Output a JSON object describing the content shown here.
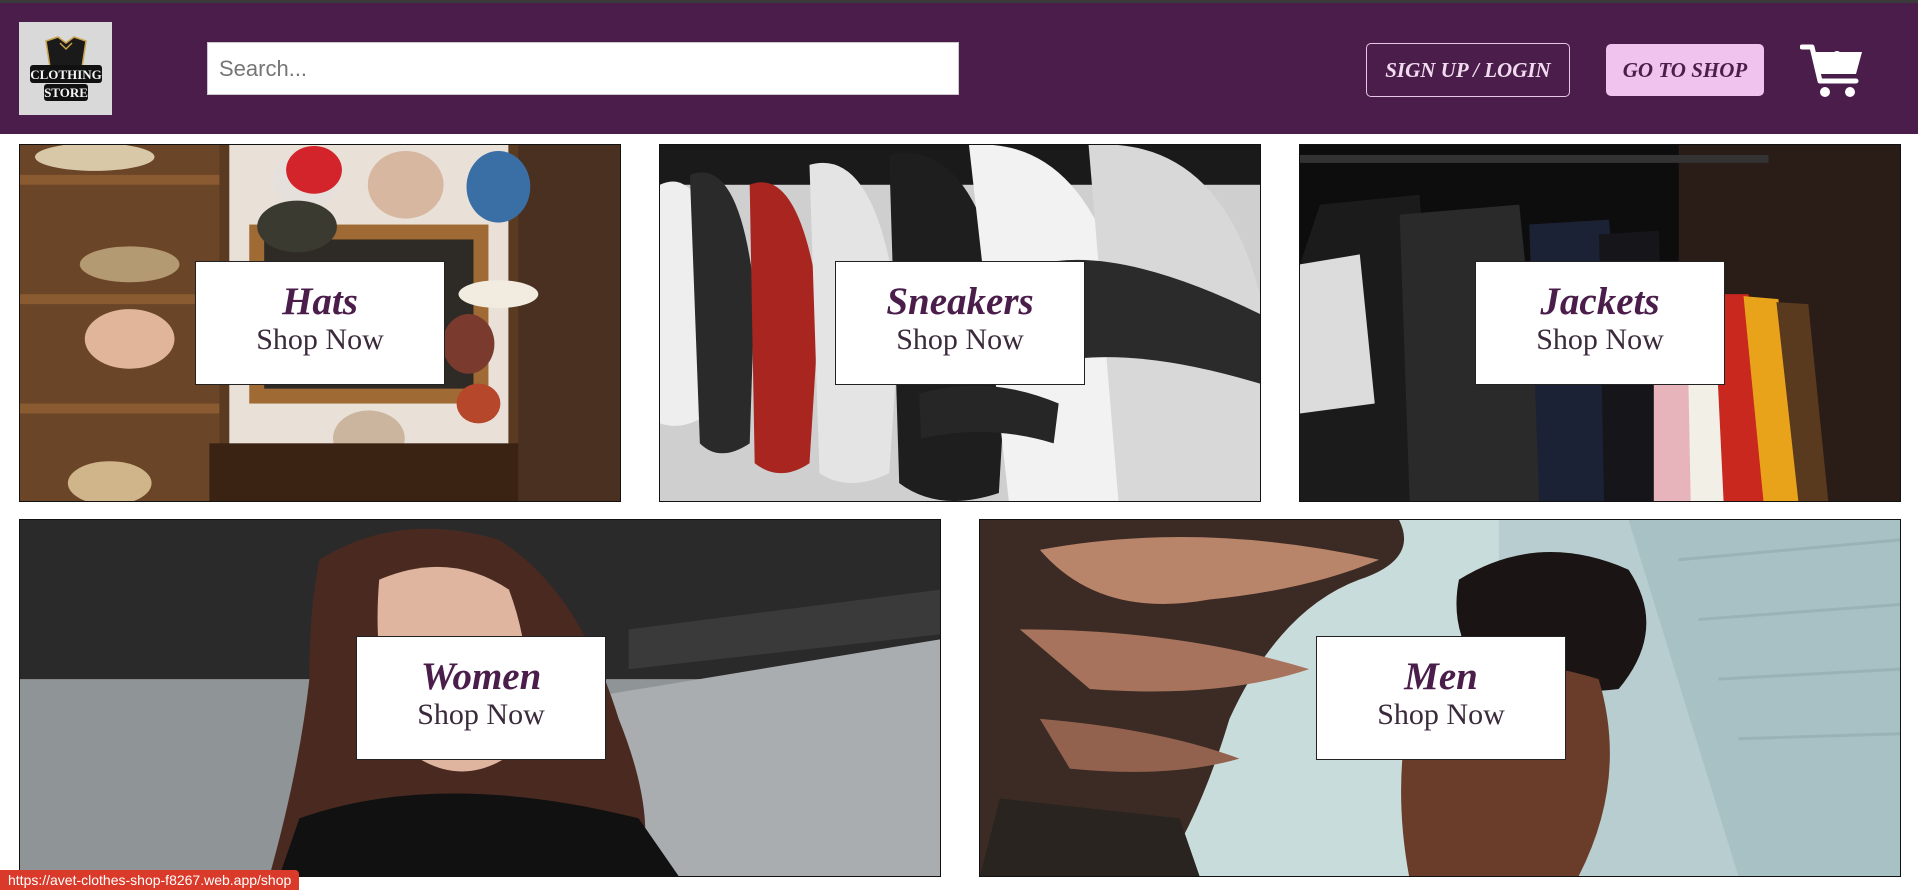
{
  "header": {
    "logo_text": [
      "CLOTHING",
      "STORE"
    ],
    "search_placeholder": "Search...",
    "login_label": "SIGN UP / LOGIN",
    "shop_label": "GO TO SHOP",
    "cart_count": "0"
  },
  "categories": [
    {
      "name": "Hats",
      "cta": "Shop Now"
    },
    {
      "name": "Sneakers",
      "cta": "Shop Now"
    },
    {
      "name": "Jackets",
      "cta": "Shop Now"
    },
    {
      "name": "Women",
      "cta": "Shop Now"
    },
    {
      "name": "Men",
      "cta": "Shop Now"
    }
  ],
  "status_url": "https://avet-clothes-shop-f8267.web.app/shop",
  "colors": {
    "brand": "#4a1d4b",
    "accent": "#f0c2ee"
  },
  "icons": [
    "cart-icon"
  ]
}
